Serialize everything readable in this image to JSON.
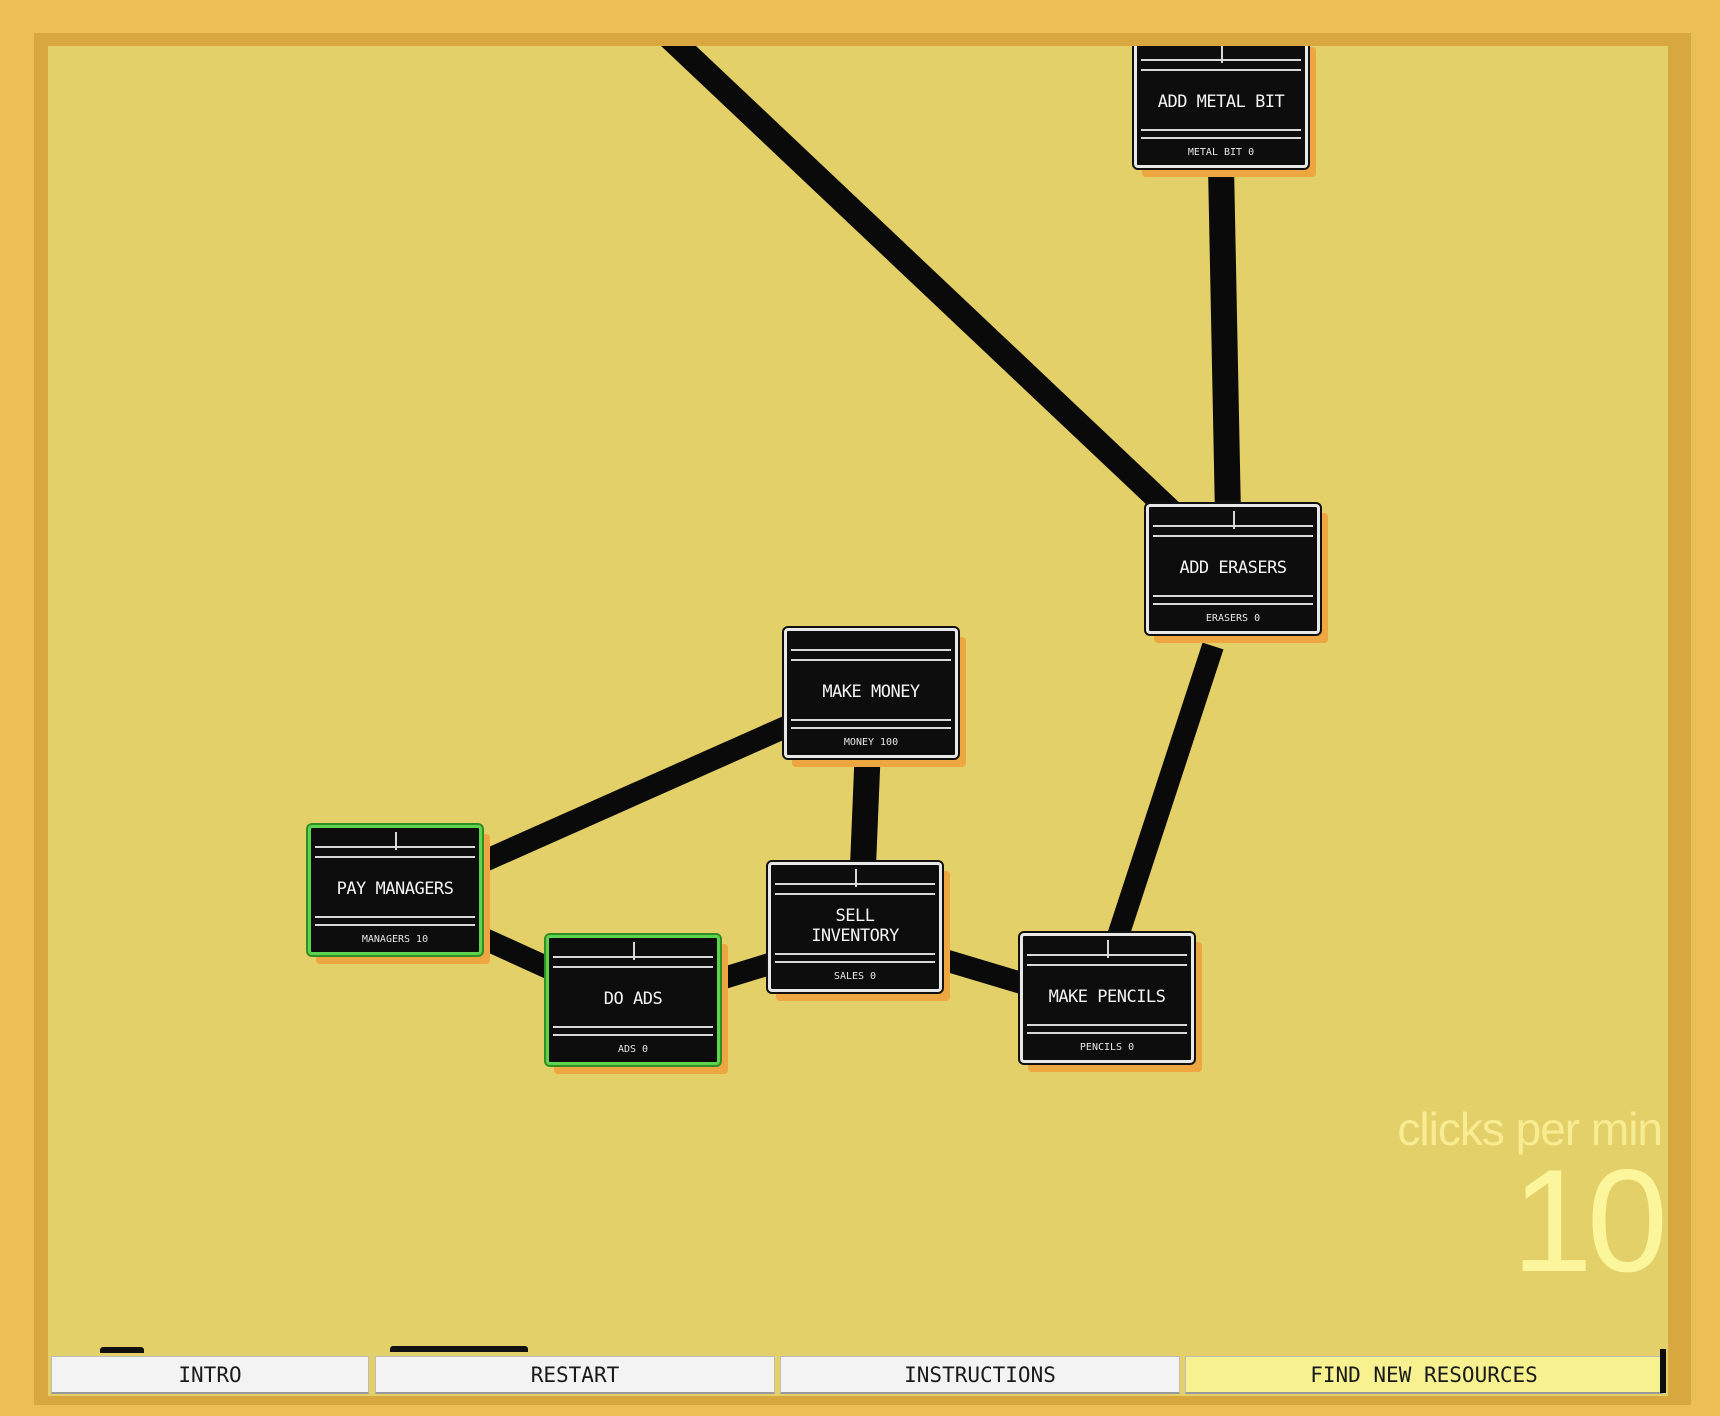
{
  "nodes": {
    "add_metal_bit": {
      "label": "ADD METAL BIT",
      "stat": "METAL BIT 0",
      "active": false
    },
    "add_erasers": {
      "label": "ADD ERASERS",
      "stat": "ERASERS 0",
      "active": false
    },
    "make_money": {
      "label": "MAKE MONEY",
      "stat": "MONEY 100",
      "active": false
    },
    "pay_managers": {
      "label": "PAY MANAGERS",
      "stat": "MANAGERS 10",
      "active": true
    },
    "sell_inventory": {
      "label": "SELL INVENTORY",
      "stat": "SALES 0",
      "active": false
    },
    "do_ads": {
      "label": "DO ADS",
      "stat": "ADS 0",
      "active": true
    },
    "make_pencils": {
      "label": "MAKE PENCILS",
      "stat": "PENCILS 0",
      "active": false
    }
  },
  "clicks": {
    "label": "clicks per min",
    "value": "10"
  },
  "menu": {
    "intro": "INTRO",
    "restart": "RESTART",
    "instructions": "INSTRUCTIONS",
    "find_new_resources": "FIND NEW RESOURCES"
  },
  "colors": {
    "page_bg": "#ecbf56",
    "frame": "#d8a73f",
    "board": "#e4d068",
    "node_fill": "#0d0d0d",
    "node_border": "#e8e8e8",
    "node_active_border": "#5ed34e",
    "node_shadow": "#eda640",
    "edge": "#0a0a0a",
    "cpm_text": "#f7ec91",
    "highlight_button": "#f7f190"
  }
}
